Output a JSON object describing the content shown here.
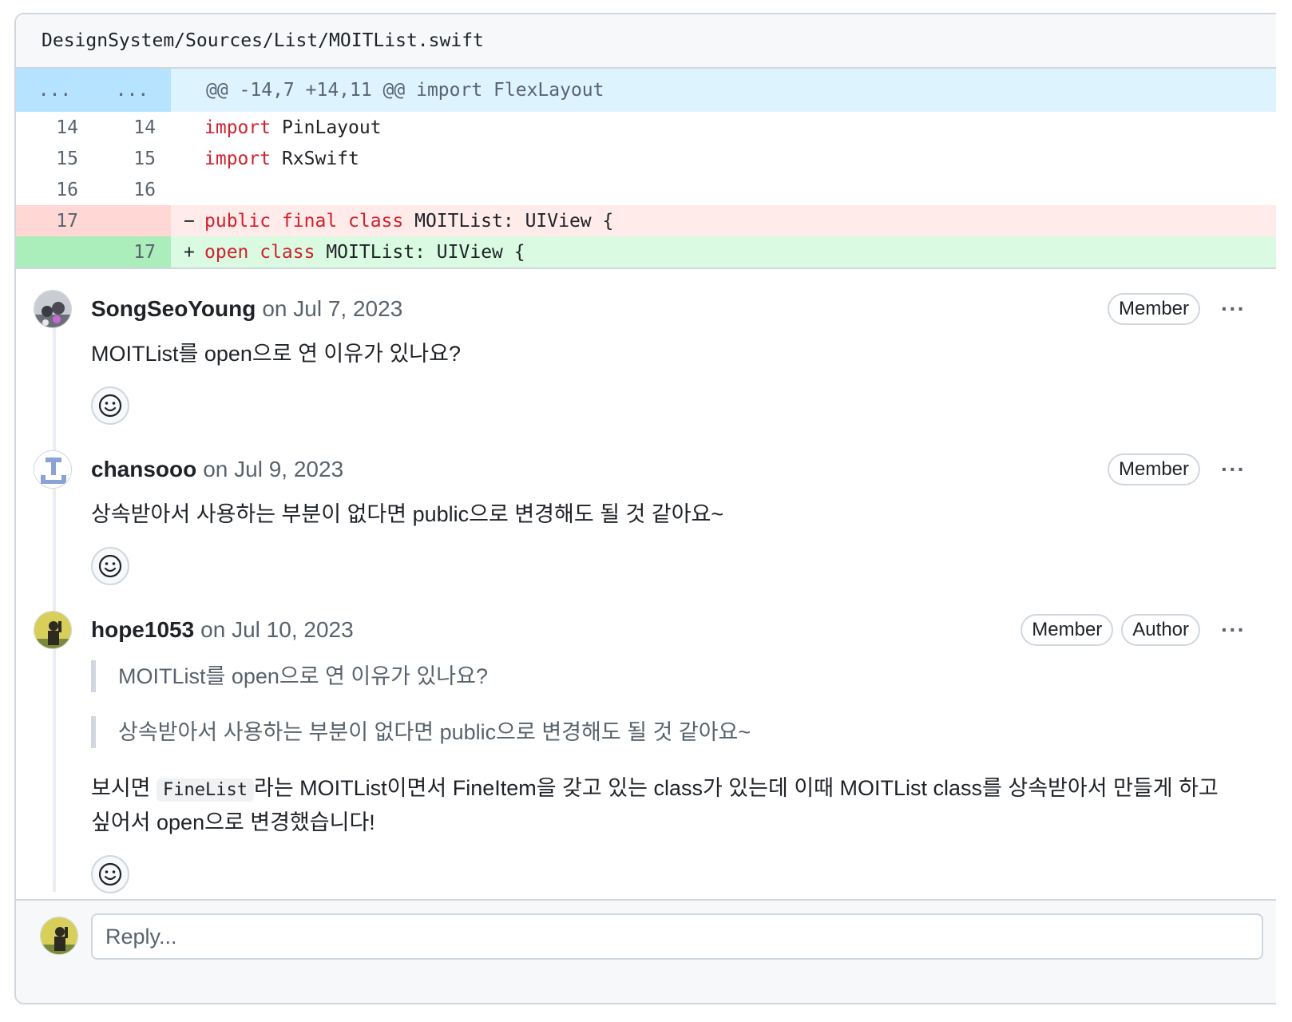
{
  "file": {
    "path": "DesignSystem/Sources/List/MOITList.swift"
  },
  "diff": {
    "hunk": {
      "left": "...",
      "right": "...",
      "header": "@@ -14,7 +14,11 @@ import FlexLayout"
    },
    "lines": [
      {
        "old": "14",
        "new": "14",
        "kw": "import",
        "rest": " PinLayout",
        "type": "context"
      },
      {
        "old": "15",
        "new": "15",
        "kw": "import",
        "rest": " RxSwift",
        "type": "context"
      },
      {
        "old": "16",
        "new": "16",
        "kw": "",
        "rest": "",
        "type": "context"
      },
      {
        "old": "17",
        "new": "",
        "sign": "−",
        "kw": "public final class",
        "rest": " MOITList: UIView {",
        "type": "del"
      },
      {
        "old": "",
        "new": "17",
        "sign": "+",
        "kw": "open class",
        "rest": " MOITList: UIView {",
        "type": "add"
      }
    ]
  },
  "comments": [
    {
      "author": "SongSeoYoung",
      "date": "on Jul 7, 2023",
      "badges": [
        "Member"
      ],
      "body": "MOITList를 open으로 연 이유가 있나요?"
    },
    {
      "author": "chansooo",
      "date": "on Jul 9, 2023",
      "badges": [
        "Member"
      ],
      "body": "상속받아서 사용하는 부분이 없다면 public으로 변경해도 될 것 같아요~"
    },
    {
      "author": "hope1053",
      "date": "on Jul 10, 2023",
      "badges": [
        "Member",
        "Author"
      ],
      "quotes": [
        "MOITList를 open으로 연 이유가 있나요?",
        "상속받아서 사용하는 부분이 없다면 public으로 변경해도 될 것 같아요~"
      ],
      "body_pre": "보시면 ",
      "body_code": "FineList",
      "body_post": "라는 MOITList이면서 FineItem을 갖고 있는 class가 있는데 이때 MOITList class를 상속받아서 만들게 하고 싶어서 open으로 변경했습니다!"
    }
  ],
  "reply": {
    "placeholder": "Reply..."
  },
  "kebab": "···"
}
